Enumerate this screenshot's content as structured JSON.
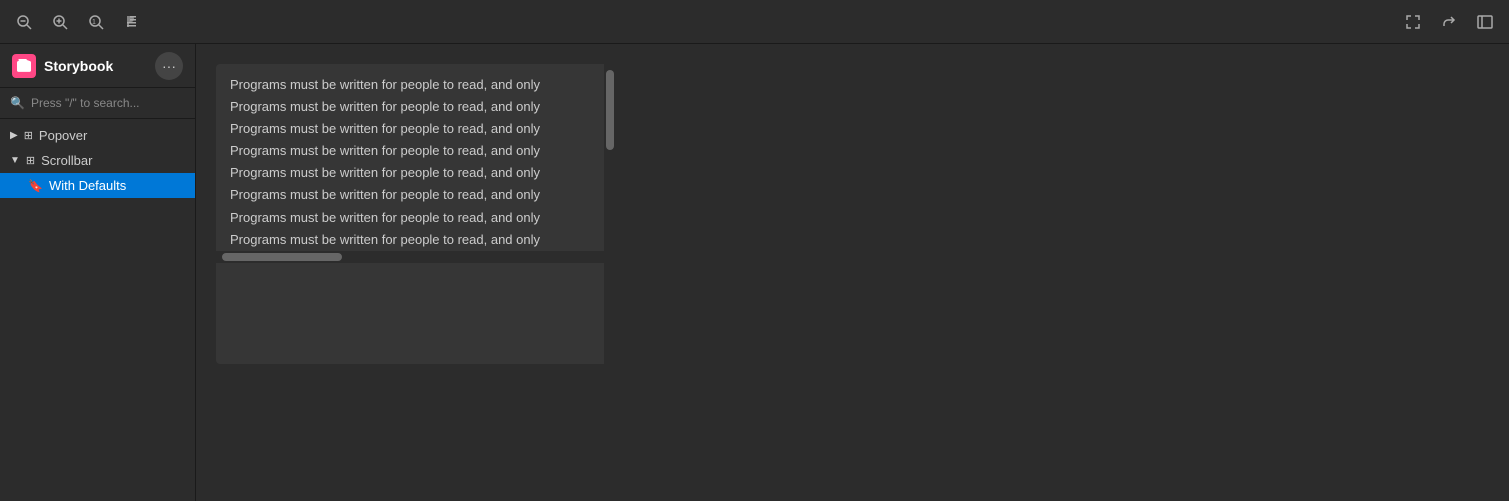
{
  "header": {
    "title": "Storybook",
    "logo_letter": "S",
    "more_icon": "•••",
    "toolbar": {
      "zoom_out_label": "zoom-out",
      "zoom_in_label": "zoom-in",
      "zoom_reset_label": "zoom-reset",
      "paragraph_label": "paragraph",
      "fullscreen_label": "fullscreen",
      "share_label": "share",
      "sidebar_toggle_label": "sidebar-toggle"
    }
  },
  "sidebar": {
    "search_placeholder": "Press \"/\" to search...",
    "items": [
      {
        "label": "Popover",
        "depth": 0,
        "chevron": "▶",
        "has_children": true
      },
      {
        "label": "Scrollbar",
        "depth": 0,
        "chevron": "▼",
        "has_children": true,
        "expanded": true
      },
      {
        "label": "With Defaults",
        "depth": 1,
        "active": true
      }
    ]
  },
  "demo": {
    "lines": [
      "Programs must be written for people to read, and only",
      "Programs must be written for people to read, and only",
      "Programs must be written for people to read, and only",
      "Programs must be written for people to read, and only",
      "Programs must be written for people to read, and only",
      "Programs must be written for people to read, and only",
      "Programs must be written for people to read, and only",
      "Programs must be written for people to read, and only"
    ]
  },
  "colors": {
    "active_bg": "#0078d7",
    "sidebar_bg": "#2c2c2c",
    "content_bg": "#2c2c2c",
    "demo_box_bg": "#363636",
    "scrollbar_thumb": "#666",
    "logo_bg": "#ff4785"
  }
}
